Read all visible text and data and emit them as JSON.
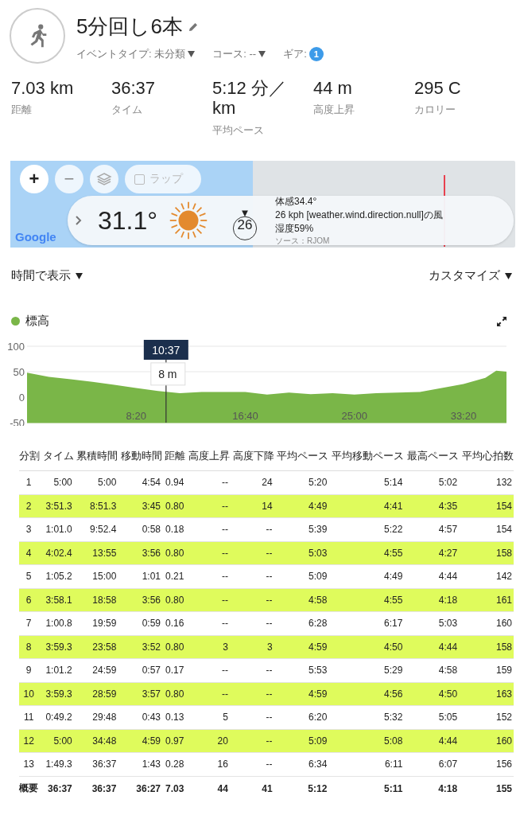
{
  "activity": {
    "title": "5分回し6本",
    "meta": [
      {
        "label": "イベントタイプ: 未分類",
        "kind": "dropdown"
      },
      {
        "label": "コース: --",
        "kind": "dropdown"
      },
      {
        "label": "ギア:",
        "kind": "badge",
        "badge": "1"
      }
    ]
  },
  "stats": [
    {
      "value": "7.03 km",
      "label": "距離"
    },
    {
      "value": "36:37",
      "label": "タイム"
    },
    {
      "value": "5:12 分／km",
      "label": "平均ペース"
    },
    {
      "value": "44 m",
      "label": "高度上昇"
    },
    {
      "value": "295 C",
      "label": "カロリー"
    }
  ],
  "map": {
    "controls": [
      {
        "label": "+",
        "kind": "zoom"
      },
      {
        "label": "−",
        "kind": "zoom"
      },
      {
        "kind": "layers"
      },
      {
        "label": "ラップ",
        "kind": "checkbox",
        "checked": false
      }
    ],
    "logo": "Google",
    "weather": {
      "temperature": "31.1°",
      "wind_speed": "26",
      "feels_like": "体感34.4°",
      "wind": "26 kph [weather.wind.direction.null]の風",
      "humidity": "湿度59%",
      "source": "ソース：RJOM"
    }
  },
  "view_bar": {
    "left": "時間で表示",
    "right": "カスタマイズ"
  },
  "chart": {
    "cursor_time": "10:37",
    "chart_data": {
      "type": "area",
      "x": [
        0,
        100,
        200,
        300,
        400,
        500,
        600,
        700,
        800,
        900,
        1000,
        1100,
        1200,
        1300,
        1400,
        1500,
        1600,
        1700,
        1800,
        1900,
        2000,
        2100,
        2150,
        2197
      ],
      "series": [
        {
          "name": "標高",
          "color": "#7ab648",
          "values": [
            48,
            40,
            35,
            30,
            24,
            18,
            12,
            8,
            10,
            10,
            10,
            5,
            9,
            6,
            8,
            5,
            8,
            9,
            10,
            18,
            26,
            38,
            52,
            50
          ]
        }
      ],
      "xlim": [
        0,
        2197
      ],
      "ylim": [
        -50,
        100
      ],
      "yticks": [
        100,
        50,
        0,
        -50
      ],
      "xticks": [
        {
          "value": 500,
          "label": "8:20"
        },
        {
          "value": 1000,
          "label": "16:40"
        },
        {
          "value": 1500,
          "label": "25:00"
        },
        {
          "value": 2000,
          "label": "33:20"
        }
      ],
      "annotations": [
        {
          "x": 637,
          "y": 8,
          "text": "8 m"
        }
      ],
      "ref_lines": [
        {
          "axis": "x",
          "value": 637,
          "color": "#333333"
        }
      ],
      "bands": [
        {
          "axis": "y",
          "from": -50,
          "to": 0,
          "color": "#7ab648"
        }
      ]
    }
  },
  "table": {
    "columns": [
      "分割",
      "タイム",
      "累積時間",
      "移動時間",
      "距離",
      "高度上昇",
      "高度下降",
      "平均ペース",
      "平均移動ペース",
      "最高ペース",
      "平均心拍数"
    ],
    "rows": [
      {
        "cells": [
          "1",
          "5:00",
          "5:00",
          "4:54",
          "0.94",
          "--",
          "24",
          "5:20",
          "5:14",
          "5:02",
          "132"
        ],
        "highlighted": false
      },
      {
        "cells": [
          "2",
          "3:51.3",
          "8:51.3",
          "3:45",
          "0.80",
          "--",
          "14",
          "4:49",
          "4:41",
          "4:35",
          "154"
        ],
        "highlighted": true
      },
      {
        "cells": [
          "3",
          "1:01.0",
          "9:52.4",
          "0:58",
          "0.18",
          "--",
          "--",
          "5:39",
          "5:22",
          "4:57",
          "154"
        ],
        "highlighted": false
      },
      {
        "cells": [
          "4",
          "4:02.4",
          "13:55",
          "3:56",
          "0.80",
          "--",
          "--",
          "5:03",
          "4:55",
          "4:27",
          "158"
        ],
        "highlighted": true
      },
      {
        "cells": [
          "5",
          "1:05.2",
          "15:00",
          "1:01",
          "0.21",
          "--",
          "--",
          "5:09",
          "4:49",
          "4:44",
          "142"
        ],
        "highlighted": false
      },
      {
        "cells": [
          "6",
          "3:58.1",
          "18:58",
          "3:56",
          "0.80",
          "--",
          "--",
          "4:58",
          "4:55",
          "4:18",
          "161"
        ],
        "highlighted": true
      },
      {
        "cells": [
          "7",
          "1:00.8",
          "19:59",
          "0:59",
          "0.16",
          "--",
          "--",
          "6:28",
          "6:17",
          "5:03",
          "160"
        ],
        "highlighted": false
      },
      {
        "cells": [
          "8",
          "3:59.3",
          "23:58",
          "3:52",
          "0.80",
          "3",
          "3",
          "4:59",
          "4:50",
          "4:44",
          "158"
        ],
        "highlighted": true
      },
      {
        "cells": [
          "9",
          "1:01.2",
          "24:59",
          "0:57",
          "0.17",
          "--",
          "--",
          "5:53",
          "5:29",
          "4:58",
          "159"
        ],
        "highlighted": false
      },
      {
        "cells": [
          "10",
          "3:59.3",
          "28:59",
          "3:57",
          "0.80",
          "--",
          "--",
          "4:59",
          "4:56",
          "4:50",
          "163"
        ],
        "highlighted": true
      },
      {
        "cells": [
          "11",
          "0:49.2",
          "29:48",
          "0:43",
          "0.13",
          "5",
          "--",
          "6:20",
          "5:32",
          "5:05",
          "152"
        ],
        "highlighted": false
      },
      {
        "cells": [
          "12",
          "5:00",
          "34:48",
          "4:59",
          "0.97",
          "20",
          "--",
          "5:09",
          "5:08",
          "4:44",
          "160"
        ],
        "highlighted": true
      },
      {
        "cells": [
          "13",
          "1:49.3",
          "36:37",
          "1:43",
          "0.28",
          "16",
          "--",
          "6:34",
          "6:11",
          "6:07",
          "156"
        ],
        "highlighted": false
      }
    ],
    "summary": [
      "概要",
      "36:37",
      "36:37",
      "36:27",
      "7.03",
      "44",
      "41",
      "5:12",
      "5:11",
      "4:18",
      "155"
    ]
  }
}
